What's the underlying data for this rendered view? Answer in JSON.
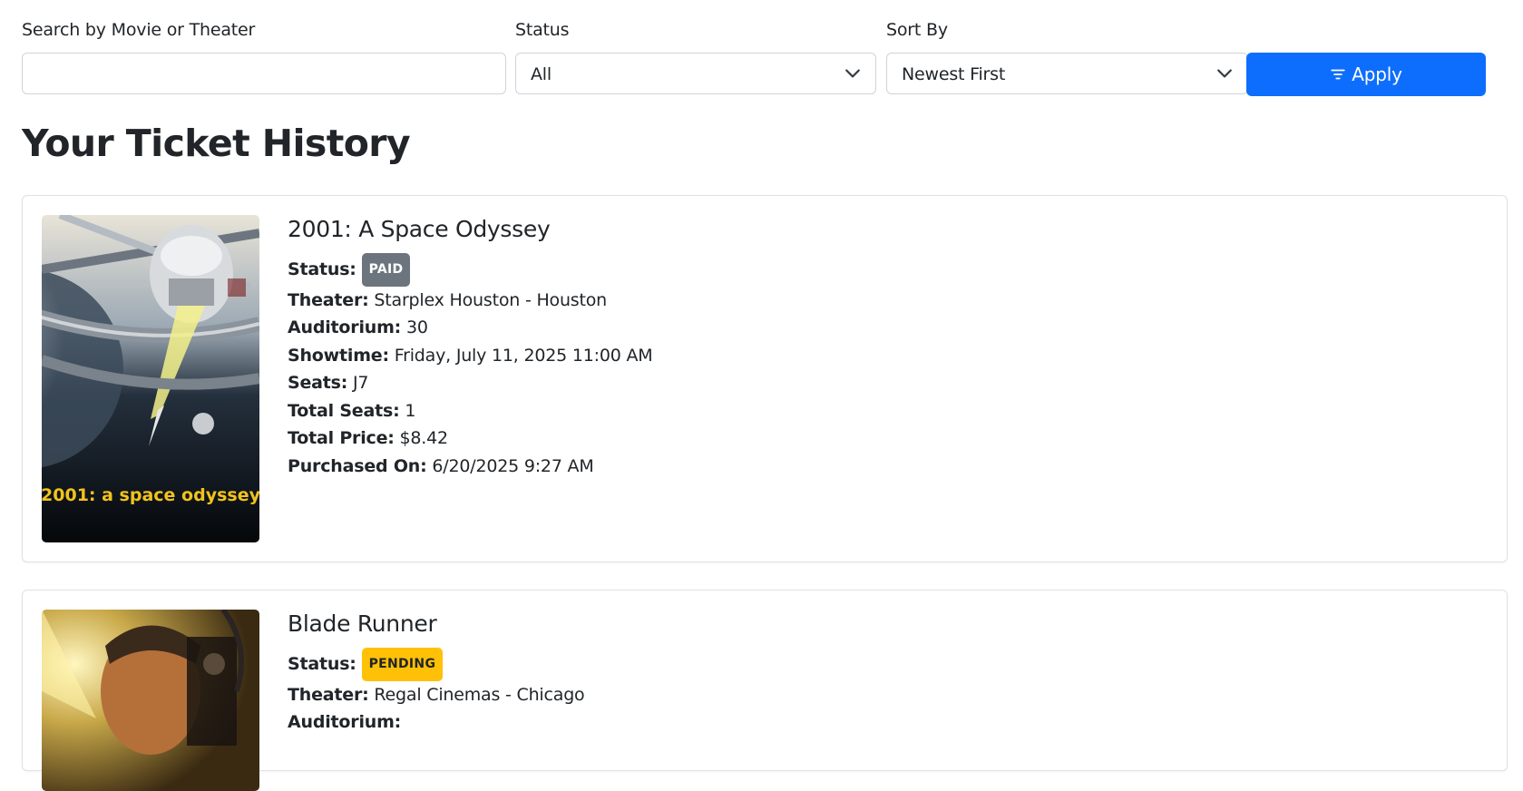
{
  "filters": {
    "search_label": "Search by Movie or Theater",
    "search_value": "",
    "search_placeholder": "",
    "status_label": "Status",
    "status_value": "All",
    "sort_label": "Sort By",
    "sort_value": "Newest First",
    "apply_label": "Apply",
    "apply_color": "#0d6efd",
    "icons": {
      "apply": "filter-icon",
      "dropdown": "chevron-down-icon"
    }
  },
  "page_title": "Your Ticket History",
  "labels": {
    "status": "Status:",
    "theater": "Theater:",
    "auditorium": "Auditorium:",
    "showtime": "Showtime:",
    "seats": "Seats:",
    "total_seats": "Total Seats:",
    "total_price": "Total Price:",
    "purchased_on": "Purchased On:"
  },
  "tickets": [
    {
      "title": "2001: A Space Odyssey",
      "status": "PAID",
      "status_color": "#6c757d",
      "theater": "Starplex Houston - Houston",
      "auditorium": "30",
      "showtime": "Friday, July 11, 2025 11:00 AM",
      "seats": "J7",
      "total_seats": "1",
      "total_price": "$8.42",
      "purchased_on": "6/20/2025 9:27 AM",
      "poster_text": "2001: a space odyssey"
    },
    {
      "title": "Blade Runner",
      "status": "PENDING",
      "status_color": "#ffc107",
      "theater": "Regal Cinemas - Chicago"
    }
  ]
}
